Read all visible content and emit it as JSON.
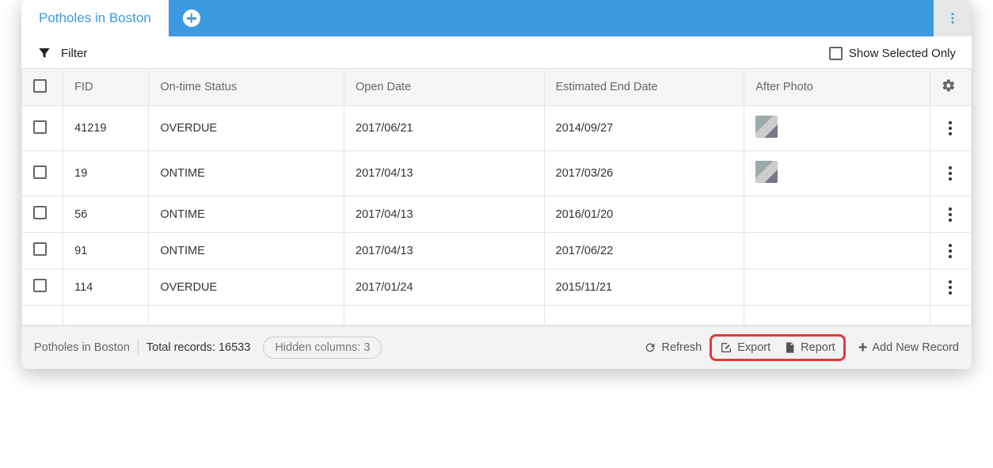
{
  "header": {
    "tab_label": "Potholes in Boston"
  },
  "filter": {
    "label": "Filter",
    "show_selected_label": "Show Selected Only"
  },
  "columns": {
    "fid": "FID",
    "status": "On-time Status",
    "open": "Open Date",
    "est": "Estimated End Date",
    "photo": "After Photo"
  },
  "rows": [
    {
      "fid": "41219",
      "status": "OVERDUE",
      "open": "2017/06/21",
      "est": "2014/09/27",
      "has_photo": true
    },
    {
      "fid": "19",
      "status": "ONTIME",
      "open": "2017/04/13",
      "est": "2017/03/26",
      "has_photo": true
    },
    {
      "fid": "56",
      "status": "ONTIME",
      "open": "2017/04/13",
      "est": "2016/01/20",
      "has_photo": false
    },
    {
      "fid": "91",
      "status": "ONTIME",
      "open": "2017/04/13",
      "est": "2017/06/22",
      "has_photo": false
    },
    {
      "fid": "114",
      "status": "OVERDUE",
      "open": "2017/01/24",
      "est": "2015/11/21",
      "has_photo": false
    }
  ],
  "footer": {
    "title": "Potholes in Boston",
    "totals": "Total records: 16533",
    "hidden": "Hidden columns: 3",
    "refresh": "Refresh",
    "export": "Export",
    "report": "Report",
    "add": "Add New Record"
  }
}
